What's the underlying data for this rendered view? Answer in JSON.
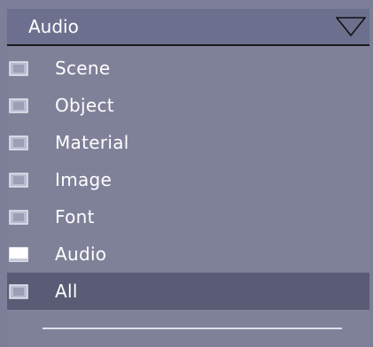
{
  "dropdown": {
    "selected_label": "Audio",
    "chevron_icon": "chevron-down-icon"
  },
  "menu": {
    "items": [
      {
        "label": "Scene",
        "icon": "file-type-icon",
        "highlighted": false,
        "checked": false
      },
      {
        "label": "Object",
        "icon": "file-type-icon",
        "highlighted": false,
        "checked": false
      },
      {
        "label": "Material",
        "icon": "file-type-icon",
        "highlighted": false,
        "checked": false
      },
      {
        "label": "Image",
        "icon": "file-type-icon",
        "highlighted": false,
        "checked": false
      },
      {
        "label": "Font",
        "icon": "file-type-icon",
        "highlighted": false,
        "checked": false
      },
      {
        "label": "Audio",
        "icon": "file-type-icon",
        "highlighted": false,
        "checked": true
      },
      {
        "label": "All",
        "icon": "file-type-icon",
        "highlighted": true,
        "checked": false
      }
    ]
  },
  "colors": {
    "background": "#7d7f98",
    "header_bg": "#6c6f8d",
    "highlight_bg": "#5a5c75",
    "text": "#ffffff"
  }
}
